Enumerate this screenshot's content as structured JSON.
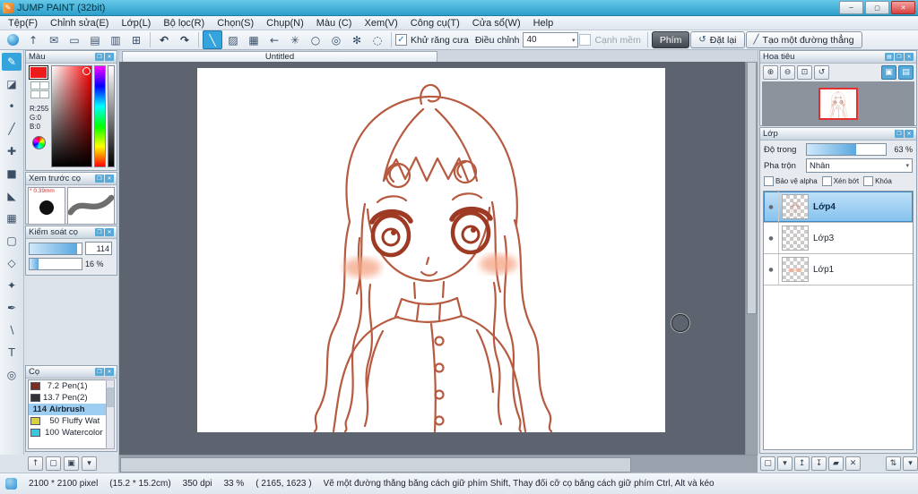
{
  "ui": {
    "accent": "#35a3dc",
    "titlebar_from": "#66c8e8",
    "titlebar_to": "#2d9fcb"
  },
  "window": {
    "title": "JUMP PAINT (32bit)"
  },
  "menubar": {
    "items": [
      "Tệp(F)",
      "Chỉnh sửa(E)",
      "Lớp(L)",
      "Bộ lọc(R)",
      "Chọn(S)",
      "Chụp(N)",
      "Màu (C)",
      "Xem(V)",
      "Công cụ(T)",
      "Cửa sổ(W)",
      "Help"
    ]
  },
  "toolbar": {
    "antialias_label": "Khử răng cưa",
    "adjust_label": "Điều chỉnh",
    "adjust_value": "40",
    "soft_edge_label": "Cạnh mềm",
    "key_button": "Phím",
    "reset_button": "Đặt lại",
    "line_button": "Tạo một đường thẳng"
  },
  "color_panel": {
    "title": "Màu",
    "selected_color": "#ec1c1c",
    "r": "R:255",
    "g": "G:0",
    "b": "B:0"
  },
  "brush_preview_panel": {
    "title": "Xem trước cọ",
    "size_label": "* 0.39mm"
  },
  "brush_control_panel": {
    "title": "Kiểm soát cọ",
    "size_value": "114",
    "opacity_value": "16 %"
  },
  "brush_panel": {
    "title": "Cọ",
    "brushes": [
      {
        "size": "7.2",
        "name": "Pen(1)",
        "chip": "#7a2e1e",
        "selected": false
      },
      {
        "size": "13.7",
        "name": "Pen(2)",
        "chip": "#333333",
        "selected": false
      },
      {
        "size": "114",
        "name": "Airbrush",
        "chip": "",
        "selected": true
      },
      {
        "size": "50",
        "name": "Fluffy Wat",
        "chip": "#d8d03a",
        "selected": false
      },
      {
        "size": "100",
        "name": "Watercolor",
        "chip": "#38c8dc",
        "selected": false
      }
    ]
  },
  "canvas": {
    "tab": "Untitled"
  },
  "navigator": {
    "title": "Hoa tiêu"
  },
  "layers_panel": {
    "title": "Lớp",
    "opacity_label": "Độ trong",
    "opacity_value": "63 %",
    "blend_label": "Pha trộn",
    "blend_value": "Nhân",
    "protect_alpha_label": "Bảo vệ alpha",
    "clipping_label": "Xén bớt",
    "lock_label": "Khóa",
    "layers": [
      {
        "name": "Lớp4",
        "selected": true
      },
      {
        "name": "Lớp3",
        "selected": false
      },
      {
        "name": "Lớp1",
        "selected": false
      }
    ]
  },
  "statusbar": {
    "dimensions": "2100 * 2100 pixel",
    "print_size": "(15.2 * 15.2cm)",
    "dpi": "350 dpi",
    "zoom": "33 %",
    "coords": "( 2165, 1623 )",
    "hint": "Vẽ một đường thẳng bằng cách giữ phím Shift, Thay đổi cỡ cọ bằng cách giữ phím Ctrl, Alt và kéo"
  },
  "icons": {
    "app": "✎",
    "minimize": "─",
    "maximize": "▢",
    "close": "✕",
    "check": "✓",
    "caret": "▾",
    "export": "↑",
    "chat": "✉",
    "monitor": "▭",
    "doc": "▤",
    "doc2": "▥",
    "grid": "⊞",
    "undo": "↶",
    "redo": "↷",
    "line": "╲",
    "hatch": "▨",
    "mesh": "▦",
    "arrow_left": "←",
    "snow": "✳",
    "circle": "○",
    "spiral": "◎",
    "burst": "✻",
    "dots": "◌",
    "reset": "↺",
    "pencil": "╱",
    "t_brush": "✎",
    "t_eraser": "◪",
    "t_dot": "•",
    "t_line": "╱",
    "t_move": "✚",
    "t_fill": "■",
    "t_bucket": "◣",
    "t_grad": "▦",
    "t_select": "▢",
    "t_lasso": "◇",
    "t_wand": "✦",
    "t_selpen": "✒",
    "t_dropper": "∖",
    "t_text": "T",
    "t_zoom": "◎",
    "panel_pop": "❐",
    "panel_close": "✕",
    "panel_menu": "▤",
    "zoom_in": "⊕",
    "zoom_out": "⊖",
    "zoom_fit": "⊡",
    "zoom_reset": "↺",
    "nav_btn1": "▣",
    "nav_btn2": "▤",
    "up": "↑",
    "page": "▢",
    "page_edit": "▣",
    "lf_new": "▢",
    "lf_menu": "▾",
    "lf_up": "↥",
    "lf_down": "↧",
    "lf_folder": "▰",
    "lf_del": "✕",
    "lf_sort": "⇅",
    "lf_more": "▾",
    "eye": "●"
  }
}
